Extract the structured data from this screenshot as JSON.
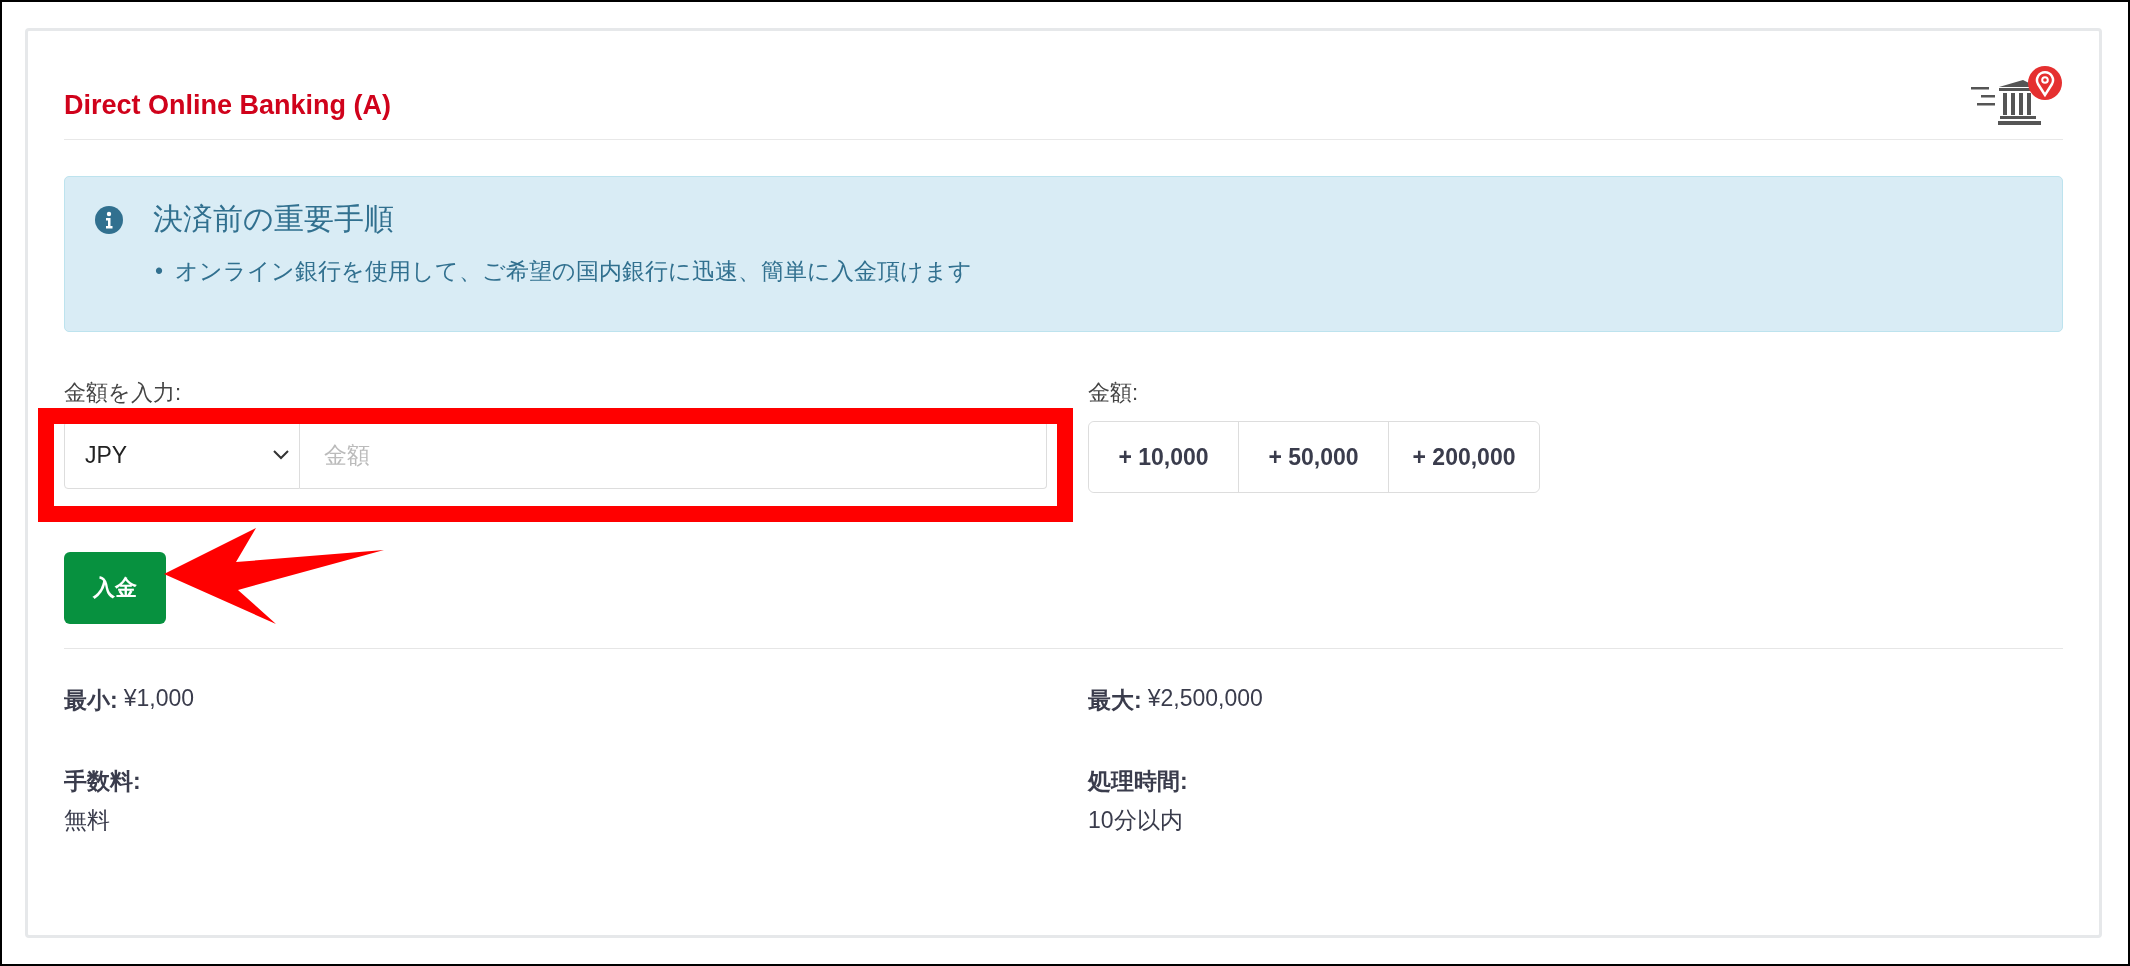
{
  "title": "Direct Online Banking (A)",
  "notice": {
    "heading": "決済前の重要手順",
    "bullets": [
      {
        "marker": "•",
        "text": "オンライン銀行を使用して、ご希望の国内銀行に迅速、簡単に入金頂けます"
      }
    ]
  },
  "amount_input": {
    "label": "金額を入力:",
    "currency": "JPY",
    "placeholder": "金額"
  },
  "quick_amounts": {
    "label": "金額:",
    "buttons": [
      "+ 10,000",
      "+ 50,000",
      "+ 200,000"
    ]
  },
  "deposit_button": "入金",
  "limits": [
    {
      "kind": "inline",
      "label": "最小:",
      "value": "¥1,000"
    },
    {
      "kind": "inline",
      "label": "最大:",
      "value": "¥2,500,000"
    },
    {
      "kind": "stacked",
      "label": "手数料:",
      "value": "無料"
    },
    {
      "kind": "stacked",
      "label": "処理時間:",
      "value": "10分以内"
    }
  ],
  "annotations": {
    "highlight_frame": true,
    "pointer_arrow": true
  }
}
